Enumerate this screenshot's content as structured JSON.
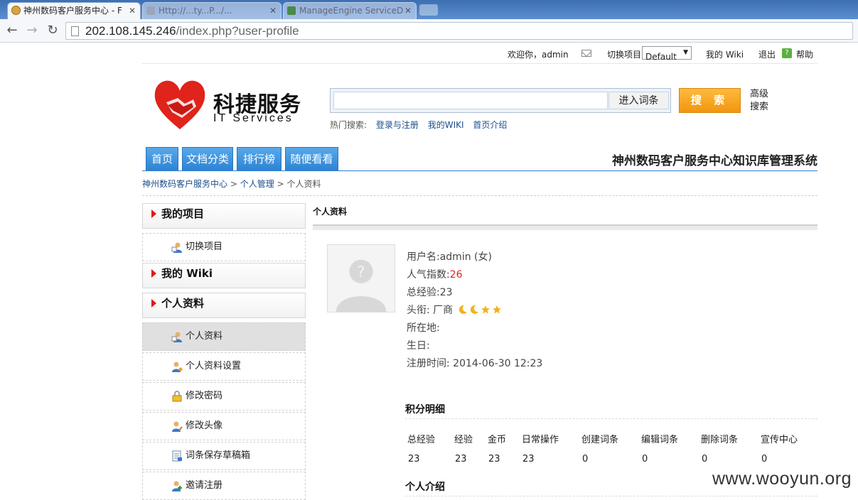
{
  "browser": {
    "tabs": [
      {
        "title": "神州数码客户服务中心 - F"
      },
      {
        "title": "Http://...ty...P.../..."
      },
      {
        "title": "ManageEngine ServiceD"
      }
    ],
    "url_host": "202.108.145.246",
    "url_path": "/index.php?user-profile"
  },
  "topbar": {
    "welcome": "欢迎你，admin",
    "switch_project_label": "切换项目",
    "project_selected": "Default",
    "my_wiki": "我的 Wiki",
    "logout": "退出",
    "help": "帮助"
  },
  "logo": {
    "cn": "科捷服务",
    "en": "IT Services"
  },
  "search": {
    "enter_button": "进入词条",
    "search_button": "搜 索",
    "advanced": "高级搜索",
    "hot_label": "热门搜索:",
    "hot_links": [
      "登录与注册",
      "我的WIKI",
      "首页介绍"
    ]
  },
  "nav": {
    "tabs": [
      "首页",
      "文档分类",
      "排行榜",
      "随便看看"
    ],
    "system_title": "神州数码客户服务中心知识库管理系统"
  },
  "breadcrumb": {
    "home": "神州数码客户服务中心",
    "sep": ">",
    "level2": "个人管理",
    "current": "个人资料"
  },
  "sidebar": {
    "my_projects": "我的项目",
    "switch_project": "切换项目",
    "my_wiki": "我的 Wiki",
    "personal": "个人资料",
    "items": [
      "个人资料",
      "个人资料设置",
      "修改密码",
      "修改头像",
      "词条保存草稿箱",
      "邀请注册"
    ]
  },
  "profile": {
    "section_title": "个人资料",
    "username": "用户名:admin (女)",
    "popularity_label": "人气指数:",
    "popularity_value": "26",
    "experience": "总经验:23",
    "rank_label": "头衔: 厂商",
    "location": "所在地:",
    "birthday": "生日:",
    "registered": "注册时间: 2014-06-30 12:23"
  },
  "points": {
    "title": "积分明细",
    "headers": [
      "总经验",
      "经验",
      "金币",
      "日常操作",
      "创建词条",
      "编辑词条",
      "删除词条",
      "宣传中心"
    ],
    "values": [
      "23",
      "23",
      "23",
      "23",
      "0",
      "0",
      "0",
      "0"
    ]
  },
  "intro": {
    "title": "个人介绍"
  },
  "watermark": "www.wooyun.org",
  "colors": {
    "accent_blue": "#2c83d3",
    "search_orange": "#f2960f",
    "red": "#e0231b"
  }
}
